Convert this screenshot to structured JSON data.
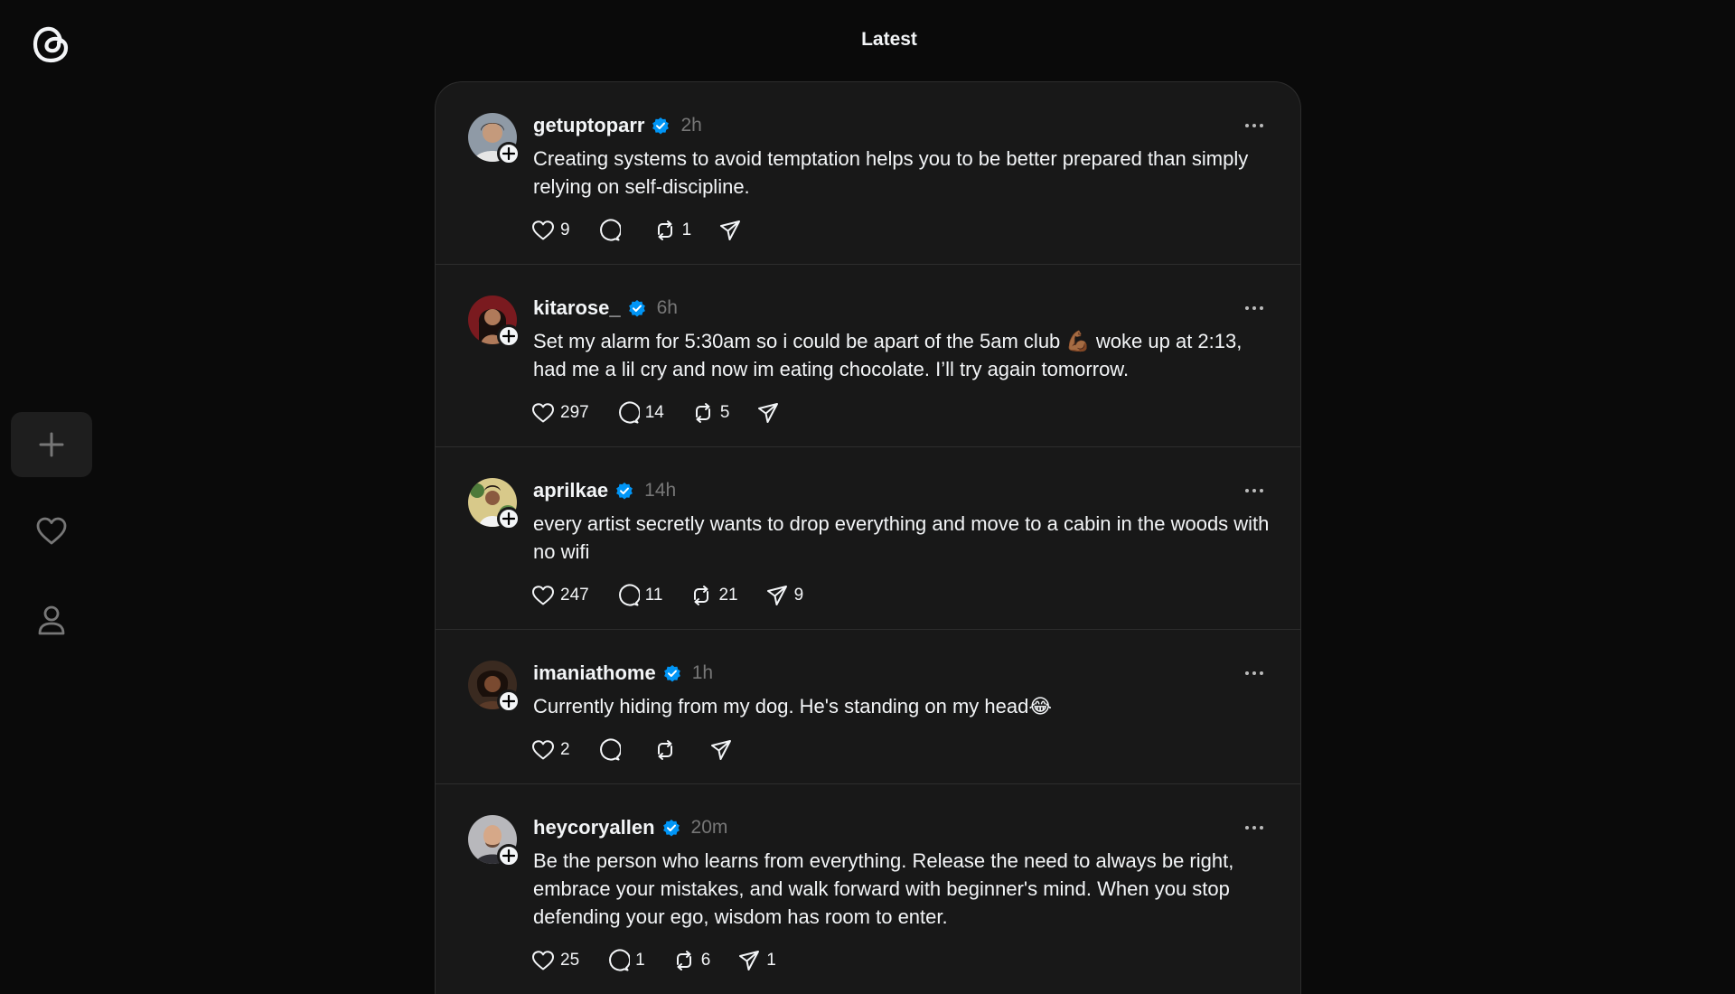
{
  "header": {
    "title": "Latest"
  },
  "sidebar": {
    "logo_icon": "threads-logo-icon",
    "items": [
      {
        "name": "create",
        "icon": "plus-icon"
      },
      {
        "name": "activity",
        "icon": "heart-icon"
      },
      {
        "name": "profile",
        "icon": "person-icon"
      }
    ]
  },
  "posts": [
    {
      "username": "getuptoparr",
      "time": "2h",
      "text": "Creating systems to avoid temptation helps you to be better prepared than simply relying on self-discipline.",
      "likes": "9",
      "replies": "",
      "reposts": "1",
      "shares": ""
    },
    {
      "username": "kitarose_",
      "time": "6h",
      "text": "Set my alarm for 5:30am so i could be apart of the 5am club 💪🏾 woke up at 2:13, had me a lil cry and now im eating chocolate. I’ll try again tomorrow.",
      "likes": "297",
      "replies": "14",
      "reposts": "5",
      "shares": ""
    },
    {
      "username": "aprilkae",
      "time": "14h",
      "text": "every artist secretly wants to drop everything and move to a cabin in the woods with no wifi",
      "likes": "247",
      "replies": "11",
      "reposts": "21",
      "shares": "9"
    },
    {
      "username": "imaniathome",
      "time": "1h",
      "text": "Currently hiding from my dog. He's standing on my head😂",
      "likes": "2",
      "replies": "",
      "reposts": "",
      "shares": ""
    },
    {
      "username": "heycoryallen",
      "time": "20m",
      "text": "Be the person who learns from everything. Release the need to always be right, embrace your mistakes, and walk forward with beginner's mind. When you stop defending your ego, wisdom has room to enter.",
      "likes": "25",
      "replies": "1",
      "reposts": "6",
      "shares": "1"
    }
  ],
  "colors": {
    "background": "#0a0a0a",
    "card": "#181818",
    "border": "#2d2d2d",
    "text": "#f3f5f7",
    "muted": "#777777",
    "verified": "#0095f6"
  }
}
